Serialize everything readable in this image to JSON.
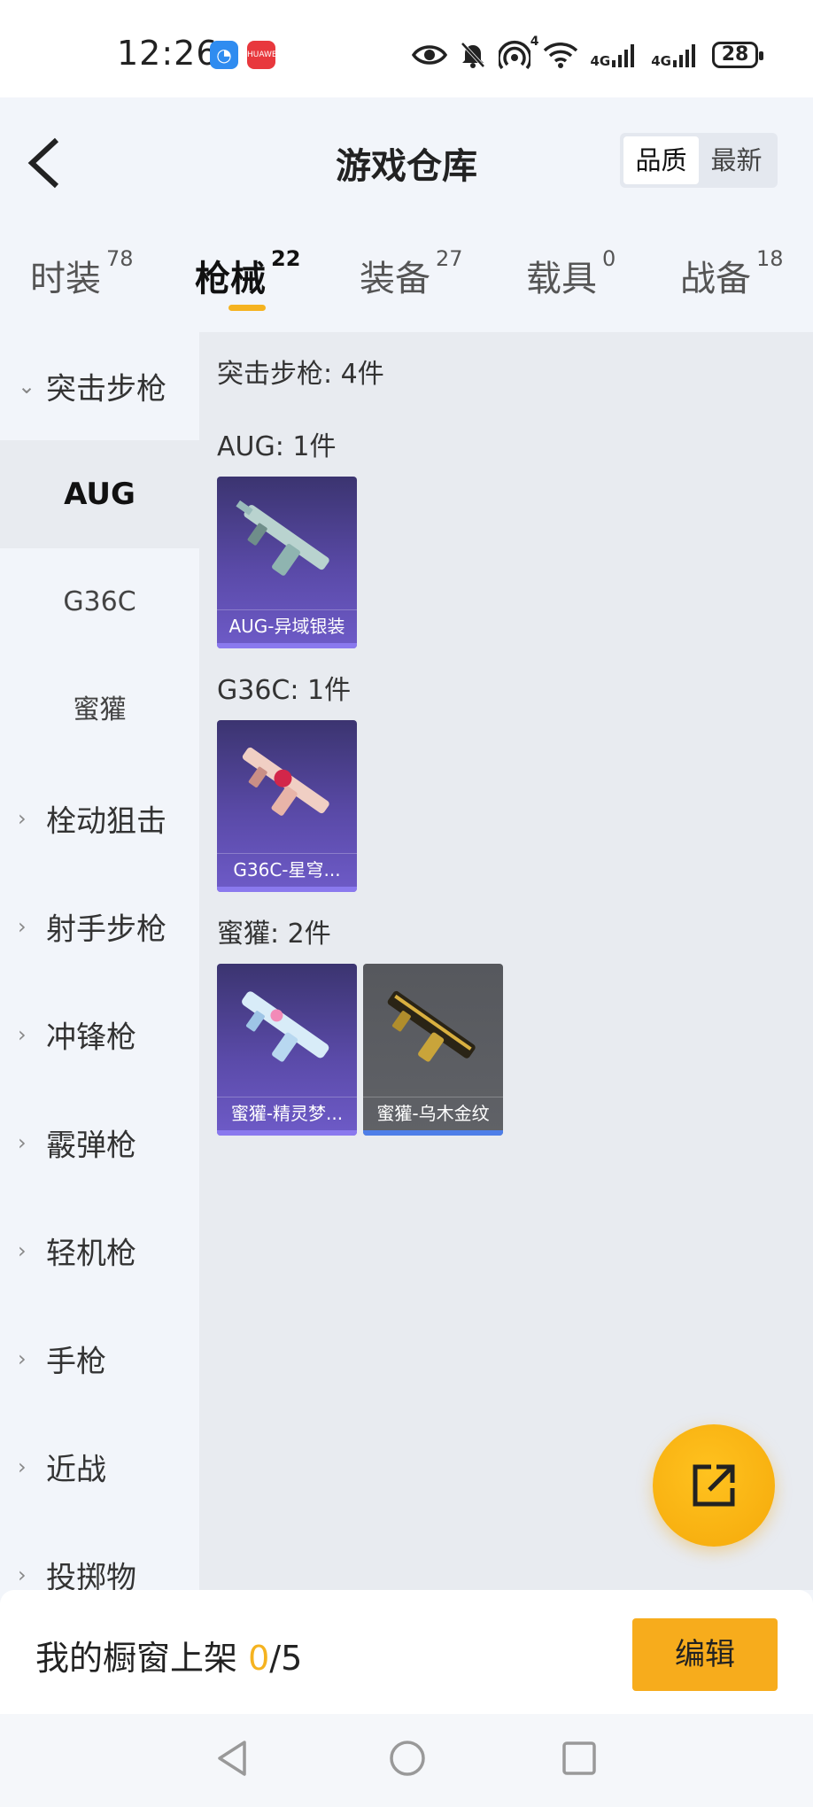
{
  "status_bar": {
    "time": "12:26",
    "app_icon_1": "assistant-app-icon",
    "app_icon_2": "huawei-appgallery-icon",
    "app_icon_2_text": "HUAWEI",
    "hotspot_count": "4",
    "net1": "4G",
    "net2": "4G",
    "battery": "28"
  },
  "header": {
    "title": "游戏仓库",
    "sort_options": [
      "品质",
      "最新"
    ],
    "active_sort": "品质"
  },
  "tabs": [
    {
      "label": "时装",
      "count": "78"
    },
    {
      "label": "枪械",
      "count": "22"
    },
    {
      "label": "装备",
      "count": "27"
    },
    {
      "label": "载具",
      "count": "0"
    },
    {
      "label": "战备",
      "count": "18"
    }
  ],
  "active_tab": "枪械",
  "sidebar": {
    "expanded_category": "突击步枪",
    "sub_items": [
      "AUG",
      "G36C",
      "蜜獾"
    ],
    "active_sub": "AUG",
    "collapsed_categories": [
      "栓动狙击",
      "射手步枪",
      "冲锋枪",
      "霰弹枪",
      "轻机枪",
      "手枪",
      "近战",
      "投掷物"
    ]
  },
  "content": {
    "section_title": "突击步枪: 4件",
    "groups": [
      {
        "title": "AUG: 1件",
        "items": [
          {
            "name": "AUG-异域银装",
            "style": "purple",
            "color": "#8fb4b0"
          }
        ]
      },
      {
        "title": "G36C: 1件",
        "items": [
          {
            "name": "G36C-星穹...",
            "style": "purple",
            "color": "#e8b4a8"
          }
        ]
      },
      {
        "title": "蜜獾: 2件",
        "items": [
          {
            "name": "蜜獾-精灵梦...",
            "style": "purple",
            "color": "#b8d8f0"
          },
          {
            "name": "蜜獾-乌木金纹",
            "style": "gray",
            "color": "#c9a43a"
          }
        ]
      }
    ]
  },
  "showcase": {
    "label": "我的橱窗上架",
    "current": "0",
    "total": "/5",
    "edit_label": "编辑"
  },
  "colors": {
    "accent": "#f5b320",
    "background": "#f2f5fa",
    "content_bg": "#e8ebf0"
  }
}
